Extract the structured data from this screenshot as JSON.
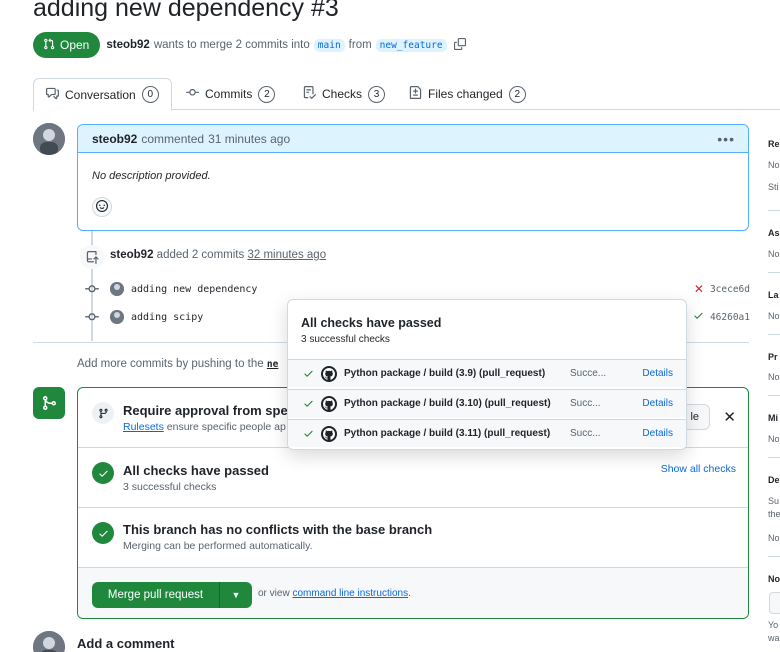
{
  "pr": {
    "title": "adding new dependency #3",
    "state": "Open",
    "author": "steob92",
    "merge_text_1": "wants to merge 2 commits into",
    "base_branch": "main",
    "from_word": "from",
    "head_branch": "new_feature"
  },
  "tabs": [
    {
      "label": "Conversation",
      "count": "0"
    },
    {
      "label": "Commits",
      "count": "2"
    },
    {
      "label": "Checks",
      "count": "3"
    },
    {
      "label": "Files changed",
      "count": "2"
    }
  ],
  "comment": {
    "author": "steob92",
    "action": "commented",
    "time": "31 minutes ago",
    "body": "No description provided."
  },
  "commits_event": {
    "author": "steob92",
    "action": "added 2 commits",
    "time": "32 minutes ago",
    "items": [
      {
        "message": "adding new dependency",
        "sha": "3cece6d",
        "status": "failure"
      },
      {
        "message": "adding scipy",
        "sha": "46260a1",
        "status": "success"
      }
    ]
  },
  "hint": {
    "text": "Add more commits by pushing to the",
    "branch_partial": "ne"
  },
  "merge_box": {
    "approval_title": "Require approval from spe",
    "approval_link": "Rulesets",
    "approval_sub": "ensure specific people ap",
    "bypass_label": "le",
    "checks_title": "All checks have passed",
    "checks_sub": "3 successful checks",
    "show_all": "Show all checks",
    "conflicts_title": "This branch has no conflicts with the base branch",
    "conflicts_sub": "Merging can be performed automatically.",
    "merge_button": "Merge pull request",
    "view_text": "or view",
    "cli_link": "command line instructions",
    "cli_period": "."
  },
  "add_comment": "Add a comment",
  "popover": {
    "title": "All checks have passed",
    "subtitle": "3 successful checks",
    "checks": [
      {
        "name": "Python package / build (3.9) (pull_request)",
        "state": "Succe...",
        "details": "Details"
      },
      {
        "name": "Python package / build (3.10) (pull_request)",
        "state": "Succ...",
        "details": "Details"
      },
      {
        "name": "Python package / build (3.11) (pull_request)",
        "state": "Succ...",
        "details": "Details"
      }
    ]
  },
  "sidebar": {
    "headings": [
      "Re",
      "As",
      "La",
      "Pr",
      "Mi",
      "De",
      "No"
    ],
    "texts": [
      "No",
      "Sti",
      "No",
      "No",
      "No",
      "No",
      "Su",
      "the",
      "No",
      "Yo",
      "wa"
    ]
  },
  "colors": {
    "accent_green": "#1f883d",
    "link_blue": "#0969da",
    "highlight_blue": "#ddf4ff",
    "failure_red": "#d1242f"
  }
}
